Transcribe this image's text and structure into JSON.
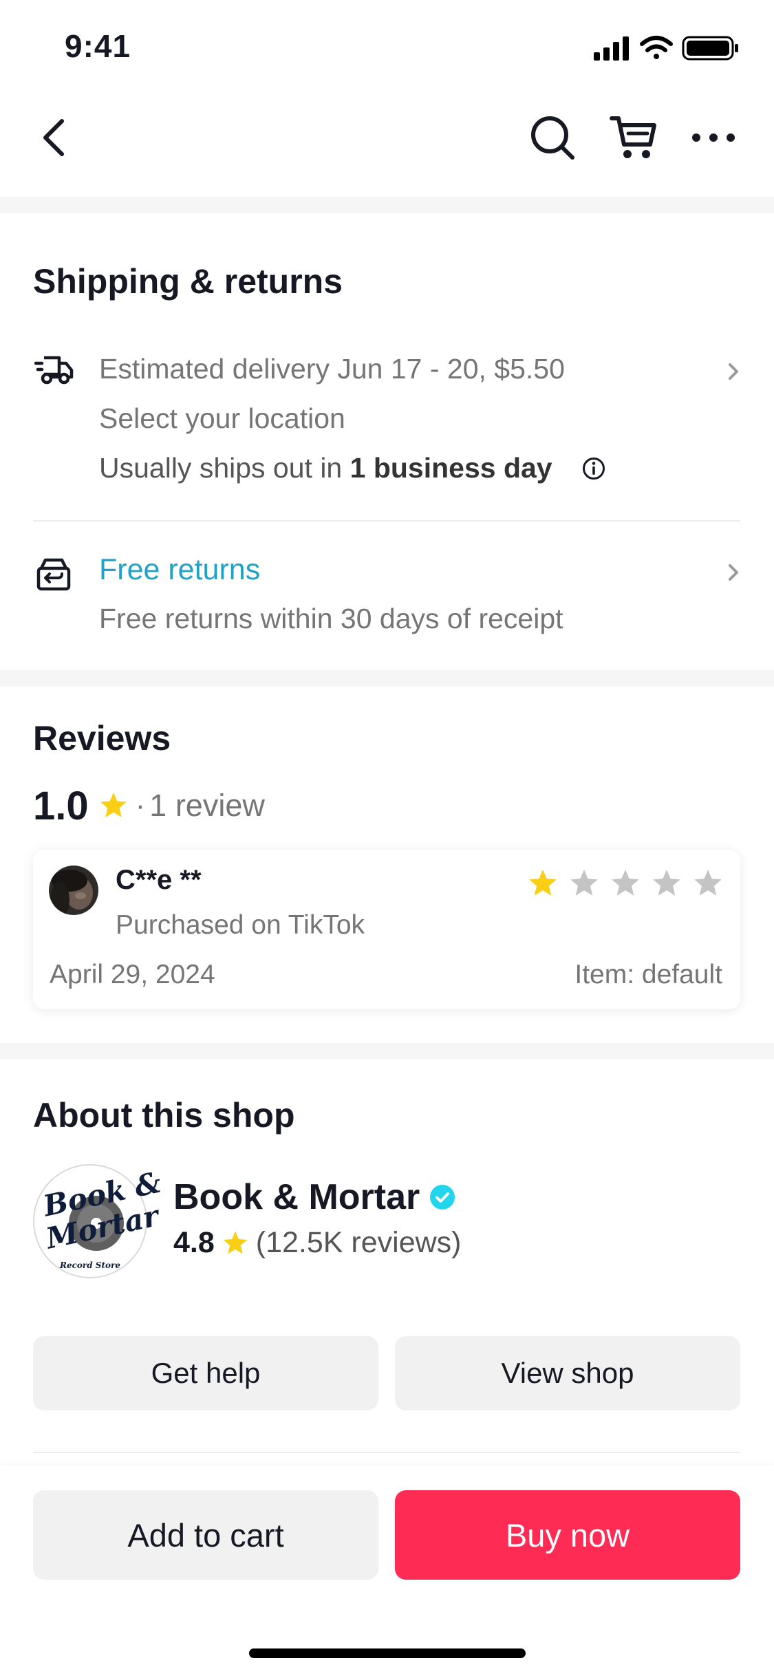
{
  "status_bar": {
    "time": "9:41"
  },
  "nav": {
    "back_icon": "chevron-left-icon",
    "search_icon": "search-icon",
    "cart_icon": "cart-icon",
    "more_icon": "more-horizontal-icon"
  },
  "shipping": {
    "title": "Shipping & returns",
    "delivery_line": "Estimated delivery Jun 17 - 20, $5.50",
    "location_line": "Select your location",
    "ships_prefix": "Usually ships out in ",
    "ships_bold": "1 business day",
    "returns_title": "Free returns",
    "returns_desc": "Free returns within 30 days of receipt"
  },
  "reviews": {
    "title": "Reviews",
    "rating": "1.0",
    "count_text": "1 review",
    "item": {
      "reviewer": "C**e **",
      "source": "Purchased on TikTok",
      "date": "April 29, 2024",
      "variant": "Item: default",
      "stars": 1,
      "max_stars": 5
    }
  },
  "shop": {
    "title": "About this shop",
    "name": "Book & Mortar",
    "rating": "4.8",
    "reviews_text": "(12.5K reviews)",
    "logo_text_1": "Book &",
    "logo_text_2": "Mortar",
    "logo_sub": "Record Store",
    "get_help": "Get help",
    "view_shop": "View shop"
  },
  "bottom_bar": {
    "add_to_cart": "Add to cart",
    "buy_now": "Buy now"
  },
  "colors": {
    "accent_red": "#FE2C55",
    "link_blue": "#1EA3C6",
    "star_gold": "#FACE15",
    "star_gray": "#C4C4C4",
    "verified_blue": "#20D5EC"
  }
}
